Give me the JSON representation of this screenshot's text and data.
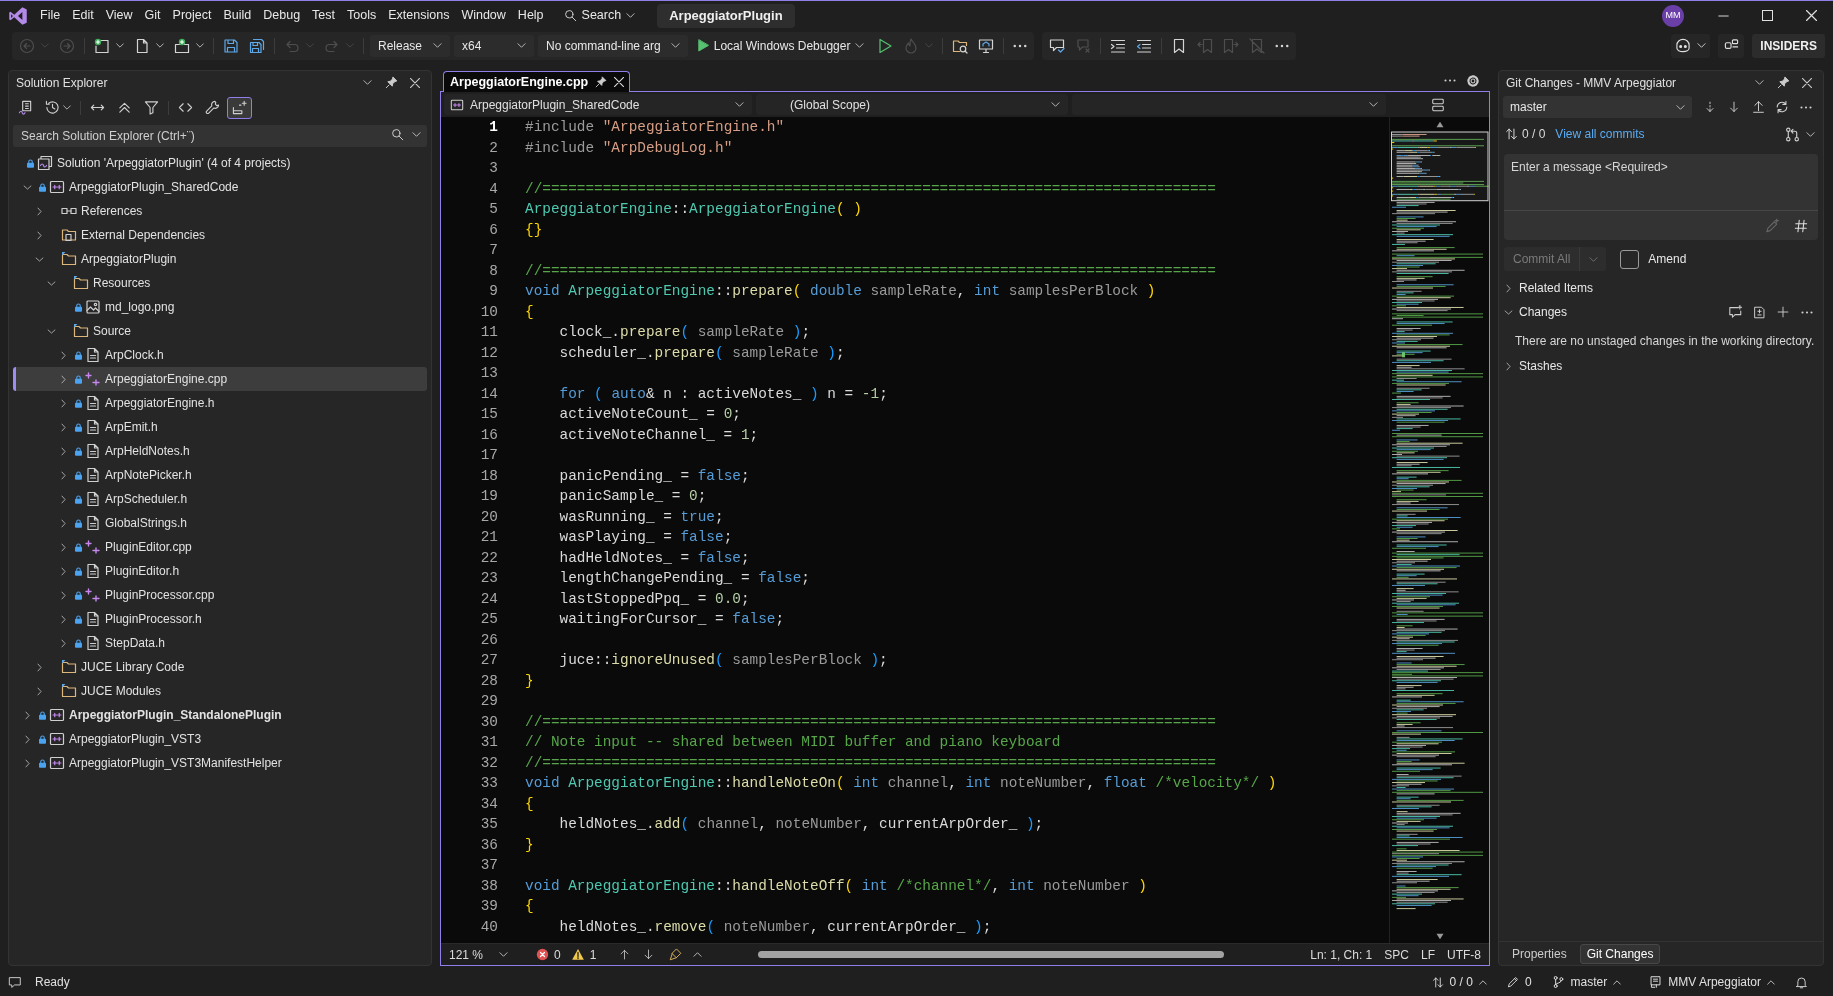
{
  "menu_bar": {
    "items": [
      "File",
      "Edit",
      "View",
      "Git",
      "Project",
      "Build",
      "Debug",
      "Test",
      "Tools",
      "Extensions",
      "Window",
      "Help"
    ],
    "search": "Search",
    "solution_name": "ArpeggiatorPlugin",
    "account_initials": "MM"
  },
  "toolbar": {
    "items": [
      {
        "kind": "back",
        "disabled": true
      },
      {
        "kind": "forward",
        "disabled": true
      },
      {
        "kind": "new-project",
        "disabled": false
      },
      {
        "kind": "add-file",
        "disabled": false
      },
      {
        "kind": "add-item",
        "disabled": false
      },
      {
        "kind": "save",
        "disabled": false
      },
      {
        "kind": "save-all",
        "disabled": false
      },
      {
        "kind": "undo",
        "disabled": true
      },
      {
        "kind": "redo",
        "disabled": true
      },
      {
        "kind": "dropdown",
        "text": "Release"
      },
      {
        "kind": "dropdown",
        "text": "x64"
      },
      {
        "kind": "dropdown",
        "text": "No command-line arg"
      },
      {
        "kind": "run",
        "text": "Local Windows Debugger"
      },
      {
        "kind": "start-without-debugging",
        "disabled": false
      },
      {
        "kind": "hot-reload",
        "disabled": true
      },
      {
        "kind": "find-in-files",
        "disabled": false
      },
      {
        "kind": "window",
        "disabled": false
      },
      {
        "kind": "more",
        "disabled": false
      }
    ],
    "editor_items": [
      {
        "kind": "comment",
        "disabled": false
      },
      {
        "kind": "uncomment",
        "disabled": true
      },
      {
        "kind": "indent",
        "disabled": false
      },
      {
        "kind": "outdent",
        "disabled": false
      },
      {
        "kind": "bookmark",
        "disabled": false
      },
      {
        "kind": "previous-bookmark",
        "disabled": true
      },
      {
        "kind": "next-bookmark",
        "disabled": true
      },
      {
        "kind": "clear-bookmarks",
        "disabled": true
      },
      {
        "kind": "more",
        "disabled": false
      }
    ],
    "badge": "INSIDERS"
  },
  "solution_explorer": {
    "title": "Solution Explorer",
    "tools": [
      {
        "kind": "home",
        "on": false
      },
      {
        "kind": "history",
        "on": false
      },
      {
        "kind": "sync",
        "on": false
      },
      {
        "kind": "collapse",
        "on": false
      },
      {
        "kind": "filter",
        "on": false
      },
      {
        "kind": "code",
        "on": false
      },
      {
        "kind": "properties",
        "on": false
      },
      {
        "kind": "preview",
        "on": true
      }
    ],
    "search": {
      "placeholder": "Search Solution Explorer (Ctrl+¨)"
    },
    "tree": [
      {
        "label": "Solution 'ArpeggiatorPlugin' (4 of 4 projects)",
        "kind": "solution",
        "locked": true,
        "selected": false,
        "children": [
          {
            "label": "ArpeggiatorPlugin_SharedCode",
            "kind": "project",
            "locked": true,
            "selected": false,
            "expanded": true,
            "startup": false,
            "children": [
              {
                "label": "References",
                "kind": "references",
                "locked": false,
                "selected": false,
                "expanded": false
              },
              {
                "label": "External Dependencies",
                "kind": "dependencies",
                "locked": false,
                "selected": false,
                "expanded": false
              },
              {
                "label": "ArpeggiatorPlugin",
                "kind": "folder",
                "locked": false,
                "selected": false,
                "expanded": true,
                "children": [
                  {
                    "label": "Resources",
                    "kind": "folder",
                    "selected": false,
                    "expanded": true,
                    "children": [
                      {
                        "label": "md_logo.png",
                        "kind": "image",
                        "locked": true,
                        "selected": false
                      }
                    ]
                  },
                  {
                    "label": "Source",
                    "kind": "folder",
                    "selected": false,
                    "expanded": true,
                    "children": [
                      {
                        "label": "ArpClock.h",
                        "kind": "header",
                        "locked": true,
                        "selected": false,
                        "expanded": false
                      },
                      {
                        "label": "ArpeggiatorEngine.cpp",
                        "kind": "cpp",
                        "locked": true,
                        "selected": true,
                        "expanded": false
                      },
                      {
                        "label": "ArpeggiatorEngine.h",
                        "kind": "header",
                        "locked": true,
                        "selected": false,
                        "expanded": false
                      },
                      {
                        "label": "ArpEmit.h",
                        "kind": "header",
                        "locked": true,
                        "selected": false,
                        "expanded": false
                      },
                      {
                        "label": "ArpHeldNotes.h",
                        "kind": "header",
                        "locked": true,
                        "selected": false,
                        "expanded": false
                      },
                      {
                        "label": "ArpNotePicker.h",
                        "kind": "header",
                        "locked": true,
                        "selected": false,
                        "expanded": false
                      },
                      {
                        "label": "ArpScheduler.h",
                        "kind": "header",
                        "locked": true,
                        "selected": false,
                        "expanded": false
                      },
                      {
                        "label": "GlobalStrings.h",
                        "kind": "header",
                        "locked": true,
                        "selected": false,
                        "expanded": false
                      },
                      {
                        "label": "PluginEditor.cpp",
                        "kind": "cpp",
                        "locked": true,
                        "selected": false,
                        "expanded": false
                      },
                      {
                        "label": "PluginEditor.h",
                        "kind": "header",
                        "locked": true,
                        "selected": false,
                        "expanded": false
                      },
                      {
                        "label": "PluginProcessor.cpp",
                        "kind": "cpp",
                        "locked": true,
                        "selected": false,
                        "expanded": false
                      },
                      {
                        "label": "PluginProcessor.h",
                        "kind": "header",
                        "locked": true,
                        "selected": false,
                        "expanded": false
                      },
                      {
                        "label": "StepData.h",
                        "kind": "header",
                        "locked": true,
                        "selected": false,
                        "expanded": false
                      }
                    ]
                  }
                ]
              },
              {
                "label": "JUCE Library Code",
                "kind": "folder",
                "locked": false,
                "selected": false,
                "expanded": false
              },
              {
                "label": "JUCE Modules",
                "kind": "folder",
                "locked": false,
                "selected": false,
                "expanded": false
              }
            ]
          },
          {
            "label": "ArpeggiatorPlugin_StandalonePlugin",
            "kind": "project",
            "locked": true,
            "selected": false,
            "expanded": false,
            "startup": true
          },
          {
            "label": "ArpeggiatorPlugin_VST3",
            "kind": "project",
            "locked": true,
            "selected": false,
            "expanded": false,
            "startup": false
          },
          {
            "label": "ArpeggiatorPlugin_VST3ManifestHelper",
            "kind": "project",
            "locked": true,
            "selected": false,
            "expanded": false,
            "startup": false
          }
        ]
      }
    ]
  },
  "editor": {
    "tabs": [
      {
        "label": "ArpeggiatorEngine.cpp",
        "selected": true
      }
    ],
    "project": "ArpeggiatorPlugin_SharedCode",
    "scope": "(Global Scope)",
    "lines": [
      {
        "number": "1",
        "current": true,
        "tokens": [
          {
            "kind": "pre",
            "text": "#include "
          },
          {
            "kind": "str",
            "text": "\"ArpeggiatorEngine.h\""
          }
        ]
      },
      {
        "number": "2",
        "current": false,
        "tokens": [
          {
            "kind": "pre",
            "text": "#include "
          },
          {
            "kind": "str",
            "text": "\"ArpDebugLog.h\""
          }
        ]
      },
      {
        "number": "3",
        "current": false
      },
      {
        "number": "4",
        "current": false,
        "tokens": [
          {
            "kind": "com",
            "text": "//=============================================================================="
          }
        ]
      },
      {
        "number": "5",
        "current": false,
        "tokens": [
          {
            "kind": "type",
            "text": "ArpeggiatorEngine"
          },
          {
            "kind": "txt",
            "text": "::"
          },
          {
            "kind": "type",
            "text": "ArpeggiatorEngine"
          },
          {
            "kind": "br1",
            "text": "( )"
          }
        ]
      },
      {
        "number": "6",
        "current": false,
        "tokens": [
          {
            "kind": "br1",
            "text": "{}"
          }
        ]
      },
      {
        "number": "7",
        "current": false
      },
      {
        "number": "8",
        "current": false,
        "tokens": [
          {
            "kind": "com",
            "text": "//=============================================================================="
          }
        ]
      },
      {
        "number": "9",
        "current": false,
        "tokens": [
          {
            "kind": "kw",
            "text": "void "
          },
          {
            "kind": "type",
            "text": "ArpeggiatorEngine"
          },
          {
            "kind": "txt",
            "text": "::"
          },
          {
            "kind": "fn",
            "text": "prepare"
          },
          {
            "kind": "br1",
            "text": "( "
          },
          {
            "kind": "kw",
            "text": "double "
          },
          {
            "kind": "param",
            "text": "sampleRate"
          },
          {
            "kind": "txt",
            "text": ", "
          },
          {
            "kind": "kw",
            "text": "int "
          },
          {
            "kind": "param",
            "text": "samplesPerBlock "
          },
          {
            "kind": "br1",
            "text": ")"
          }
        ]
      },
      {
        "number": "10",
        "current": false,
        "tokens": [
          {
            "kind": "br1",
            "text": "{"
          }
        ]
      },
      {
        "number": "11",
        "current": false,
        "tokens": [
          {
            "kind": "txt",
            "text": "    clock_."
          },
          {
            "kind": "fn",
            "text": "prepare"
          },
          {
            "kind": "br2",
            "text": "( "
          },
          {
            "kind": "param",
            "text": "sampleRate "
          },
          {
            "kind": "br2",
            "text": ")"
          },
          {
            "kind": "txt",
            "text": ";"
          }
        ]
      },
      {
        "number": "12",
        "current": false,
        "tokens": [
          {
            "kind": "txt",
            "text": "    scheduler_."
          },
          {
            "kind": "fn",
            "text": "prepare"
          },
          {
            "kind": "br2",
            "text": "( "
          },
          {
            "kind": "param",
            "text": "sampleRate "
          },
          {
            "kind": "br2",
            "text": ")"
          },
          {
            "kind": "txt",
            "text": ";"
          }
        ]
      },
      {
        "number": "13",
        "current": false
      },
      {
        "number": "14",
        "current": false,
        "tokens": [
          {
            "kind": "kw",
            "text": "    for "
          },
          {
            "kind": "br2",
            "text": "( "
          },
          {
            "kind": "kw",
            "text": "auto"
          },
          {
            "kind": "txt",
            "text": "& n : activeNotes_ "
          },
          {
            "kind": "br2",
            "text": ")"
          },
          {
            "kind": "txt",
            "text": " n = "
          },
          {
            "kind": "num",
            "text": "-1"
          },
          {
            "kind": "txt",
            "text": ";"
          }
        ]
      },
      {
        "number": "15",
        "current": false,
        "tokens": [
          {
            "kind": "txt",
            "text": "    activeNoteCount_ = "
          },
          {
            "kind": "num",
            "text": "0"
          },
          {
            "kind": "txt",
            "text": ";"
          }
        ]
      },
      {
        "number": "16",
        "current": false,
        "tokens": [
          {
            "kind": "txt",
            "text": "    activeNoteChannel_ = "
          },
          {
            "kind": "num",
            "text": "1"
          },
          {
            "kind": "txt",
            "text": ";"
          }
        ]
      },
      {
        "number": "17",
        "current": false
      },
      {
        "number": "18",
        "current": false,
        "tokens": [
          {
            "kind": "txt",
            "text": "    panicPending_ = "
          },
          {
            "kind": "kw",
            "text": "false"
          },
          {
            "kind": "txt",
            "text": ";"
          }
        ]
      },
      {
        "number": "19",
        "current": false,
        "tokens": [
          {
            "kind": "txt",
            "text": "    panicSample_ = "
          },
          {
            "kind": "num",
            "text": "0"
          },
          {
            "kind": "txt",
            "text": ";"
          }
        ]
      },
      {
        "number": "20",
        "current": false,
        "tokens": [
          {
            "kind": "txt",
            "text": "    wasRunning_ = "
          },
          {
            "kind": "kw",
            "text": "true"
          },
          {
            "kind": "txt",
            "text": ";"
          }
        ]
      },
      {
        "number": "21",
        "current": false,
        "tokens": [
          {
            "kind": "txt",
            "text": "    wasPlaying_ = "
          },
          {
            "kind": "kw",
            "text": "false"
          },
          {
            "kind": "txt",
            "text": ";"
          }
        ]
      },
      {
        "number": "22",
        "current": false,
        "tokens": [
          {
            "kind": "txt",
            "text": "    hadHeldNotes_ = "
          },
          {
            "kind": "kw",
            "text": "false"
          },
          {
            "kind": "txt",
            "text": ";"
          }
        ]
      },
      {
        "number": "23",
        "current": false,
        "tokens": [
          {
            "kind": "txt",
            "text": "    lengthChangePending_ = "
          },
          {
            "kind": "kw",
            "text": "false"
          },
          {
            "kind": "txt",
            "text": ";"
          }
        ]
      },
      {
        "number": "24",
        "current": false,
        "tokens": [
          {
            "kind": "txt",
            "text": "    lastStoppedPpq_ = "
          },
          {
            "kind": "num",
            "text": "0.0"
          },
          {
            "kind": "txt",
            "text": ";"
          }
        ]
      },
      {
        "number": "25",
        "current": false,
        "tokens": [
          {
            "kind": "txt",
            "text": "    waitingForCursor_ = "
          },
          {
            "kind": "kw",
            "text": "false"
          },
          {
            "kind": "txt",
            "text": ";"
          }
        ]
      },
      {
        "number": "26",
        "current": false
      },
      {
        "number": "27",
        "current": false,
        "tokens": [
          {
            "kind": "txt",
            "text": "    juce::"
          },
          {
            "kind": "fn",
            "text": "ignoreUnused"
          },
          {
            "kind": "br2",
            "text": "( "
          },
          {
            "kind": "param",
            "text": "samplesPerBlock "
          },
          {
            "kind": "br2",
            "text": ")"
          },
          {
            "kind": "txt",
            "text": ";"
          }
        ]
      },
      {
        "number": "28",
        "current": false,
        "tokens": [
          {
            "kind": "br1",
            "text": "}"
          }
        ]
      },
      {
        "number": "29",
        "current": false
      },
      {
        "number": "30",
        "current": false,
        "tokens": [
          {
            "kind": "com",
            "text": "//=============================================================================="
          }
        ]
      },
      {
        "number": "31",
        "current": false,
        "tokens": [
          {
            "kind": "com",
            "text": "// Note input -- shared between MIDI buffer and piano keyboard"
          }
        ]
      },
      {
        "number": "32",
        "current": false,
        "tokens": [
          {
            "kind": "com",
            "text": "//=============================================================================="
          }
        ]
      },
      {
        "number": "33",
        "current": false,
        "tokens": [
          {
            "kind": "kw",
            "text": "void "
          },
          {
            "kind": "type",
            "text": "ArpeggiatorEngine"
          },
          {
            "kind": "txt",
            "text": "::"
          },
          {
            "kind": "fn",
            "text": "handleNoteOn"
          },
          {
            "kind": "br1",
            "text": "( "
          },
          {
            "kind": "kw",
            "text": "int "
          },
          {
            "kind": "param",
            "text": "channel"
          },
          {
            "kind": "txt",
            "text": ", "
          },
          {
            "kind": "kw",
            "text": "int "
          },
          {
            "kind": "param",
            "text": "noteNumber"
          },
          {
            "kind": "txt",
            "text": ", "
          },
          {
            "kind": "kw",
            "text": "float "
          },
          {
            "kind": "com",
            "text": "/*velocity*/ "
          },
          {
            "kind": "br1",
            "text": ")"
          }
        ]
      },
      {
        "number": "34",
        "current": false,
        "tokens": [
          {
            "kind": "br1",
            "text": "{"
          }
        ]
      },
      {
        "number": "35",
        "current": false,
        "tokens": [
          {
            "kind": "txt",
            "text": "    heldNotes_."
          },
          {
            "kind": "fn",
            "text": "add"
          },
          {
            "kind": "br2",
            "text": "( "
          },
          {
            "kind": "param",
            "text": "channel"
          },
          {
            "kind": "txt",
            "text": ", "
          },
          {
            "kind": "param",
            "text": "noteNumber"
          },
          {
            "kind": "txt",
            "text": ", currentArpOrder_ "
          },
          {
            "kind": "br2",
            "text": ")"
          },
          {
            "kind": "txt",
            "text": ";"
          }
        ]
      },
      {
        "number": "36",
        "current": false,
        "tokens": [
          {
            "kind": "br1",
            "text": "}"
          }
        ]
      },
      {
        "number": "37",
        "current": false
      },
      {
        "number": "38",
        "current": false,
        "tokens": [
          {
            "kind": "kw",
            "text": "void "
          },
          {
            "kind": "type",
            "text": "ArpeggiatorEngine"
          },
          {
            "kind": "txt",
            "text": "::"
          },
          {
            "kind": "fn",
            "text": "handleNoteOff"
          },
          {
            "kind": "br1",
            "text": "( "
          },
          {
            "kind": "kw",
            "text": "int "
          },
          {
            "kind": "com",
            "text": "/*channel*/"
          },
          {
            "kind": "txt",
            "text": ", "
          },
          {
            "kind": "kw",
            "text": "int "
          },
          {
            "kind": "param",
            "text": "noteNumber "
          },
          {
            "kind": "br1",
            "text": ")"
          }
        ]
      },
      {
        "number": "39",
        "current": false,
        "tokens": [
          {
            "kind": "br1",
            "text": "{"
          }
        ]
      },
      {
        "number": "40",
        "current": false,
        "tokens": [
          {
            "kind": "txt",
            "text": "    heldNotes_."
          },
          {
            "kind": "fn",
            "text": "remove"
          },
          {
            "kind": "br2",
            "text": "( "
          },
          {
            "kind": "param",
            "text": "noteNumber"
          },
          {
            "kind": "txt",
            "text": ", currentArpOrder_ "
          },
          {
            "kind": "br2",
            "text": ")"
          },
          {
            "kind": "txt",
            "text": ";"
          }
        ]
      }
    ],
    "status": {
      "zoom": "121 %",
      "errors": "0",
      "warnings": "1",
      "position": "Ln: 1, Ch: 1",
      "indentation": "SPC",
      "line_ending": "LF",
      "encoding": "UTF-8"
    }
  },
  "git_changes": {
    "title": "Git Changes - MMV Arpeggiator",
    "branch": "master",
    "sync": "0 / 0",
    "history_link": "View all commits",
    "message": {
      "placeholder": "Enter a message <Required>",
      "suggest_disabled": true
    },
    "commit_button": {
      "label": "Commit All",
      "disabled": true
    },
    "amend": {
      "label": "Amend",
      "checked": false
    },
    "sections": [
      {
        "kind": "related",
        "label": "Related Items",
        "expanded": false
      },
      {
        "kind": "changes",
        "label": "Changes",
        "expanded": true,
        "note": "There are no unstaged changes in the working directory."
      },
      {
        "kind": "stashes",
        "label": "Stashes",
        "expanded": false
      }
    ],
    "tabs": [
      {
        "label": "Properties",
        "selected": false
      },
      {
        "label": "Git Changes",
        "selected": true
      }
    ]
  },
  "status_bar": {
    "message": "Ready",
    "sync": "0 / 0",
    "pending_edits": "0",
    "branch": "master",
    "repository": "MMV Arpeggiator"
  }
}
